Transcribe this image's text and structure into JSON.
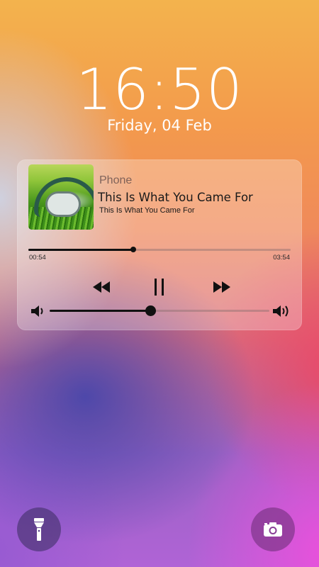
{
  "lockscreen": {
    "time": "16:50",
    "date": "Friday, 04 Feb"
  },
  "player": {
    "source": "Phone",
    "title": "This Is What You Came For",
    "subtitle": "This Is What You Came For",
    "elapsed": "00:54",
    "total": "03:54",
    "progress_fraction": 0.4,
    "volume_fraction": 0.46,
    "controls": {
      "rewind_icon": "rewind-icon",
      "pause_icon": "pause-icon",
      "forward_icon": "fast-forward-icon",
      "volume_low_icon": "volume-low-icon",
      "volume_high_icon": "volume-high-icon"
    },
    "album_art_icon": "headphones-on-grass"
  },
  "shortcuts": {
    "left_icon": "flashlight-icon",
    "right_icon": "camera-icon"
  },
  "colors": {
    "text_primary": "#ffffff",
    "control_dark": "#111111"
  }
}
